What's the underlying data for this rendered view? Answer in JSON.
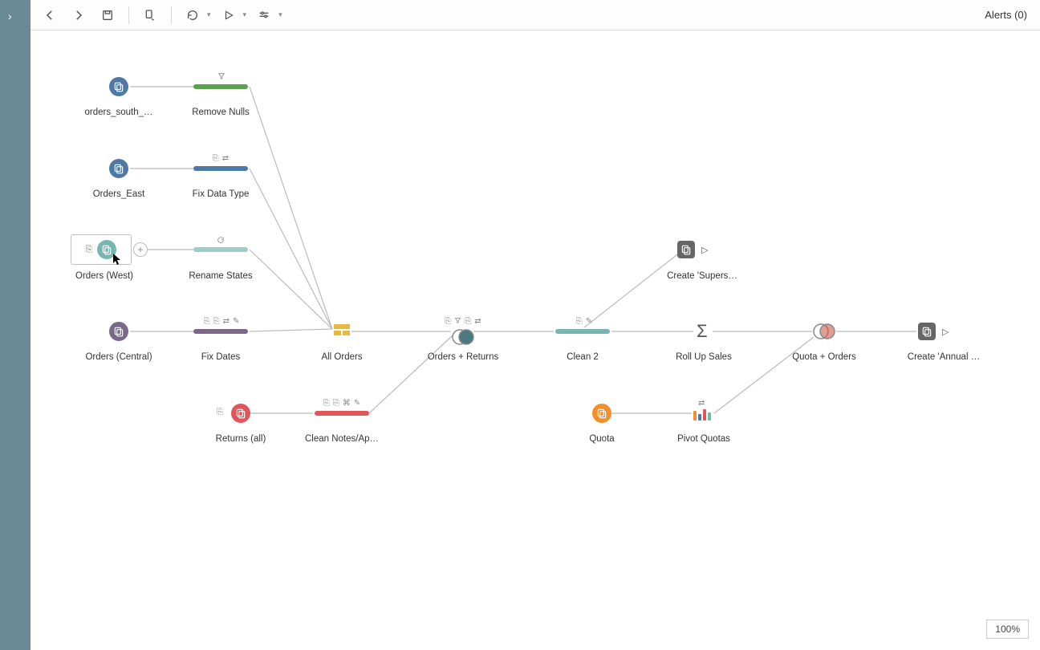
{
  "toolbar": {
    "alerts_label": "Alerts (0)"
  },
  "zoom": "100%",
  "nodes": {
    "orders_south": "orders_south_…",
    "remove_nulls": "Remove Nulls",
    "orders_east": "Orders_East",
    "fix_data_type": "Fix Data Type",
    "orders_west": "Orders (West)",
    "rename_states": "Rename States",
    "orders_central": "Orders (Central)",
    "fix_dates": "Fix Dates",
    "all_orders": "All Orders",
    "orders_returns": "Orders + Returns",
    "clean2": "Clean 2",
    "rollup": "Roll Up Sales",
    "quota_orders": "Quota + Orders",
    "create_annual": "Create 'Annual …",
    "create_supers": "Create 'Supers…",
    "returns_all": "Returns (all)",
    "clean_notes": "Clean Notes/Ap…",
    "quota": "Quota",
    "pivot_quotas": "Pivot Quotas"
  },
  "colors": {
    "blue": "#4e79a6",
    "green": "#59a14f",
    "teal": "#76b7b2",
    "purple": "#7b6888",
    "pink": "#e15759",
    "orange": "#f28e2b",
    "grey": "#666666"
  }
}
